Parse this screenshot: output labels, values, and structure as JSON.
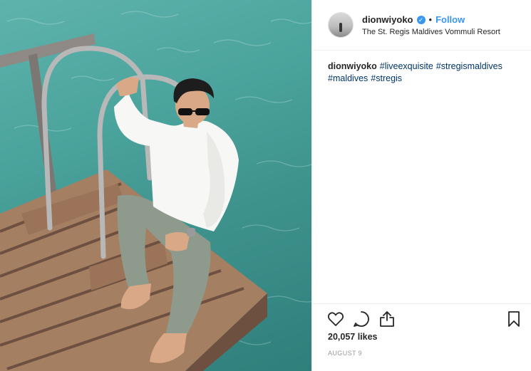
{
  "post": {
    "username": "dionwiyoko",
    "verified": true,
    "separator": "•",
    "follow_label": "Follow",
    "location": "The St. Regis Maldives Vommuli Resort",
    "caption": {
      "username": "dionwiyoko",
      "hashtags": [
        "#liveexquisite",
        "#stregismaldives",
        "#maldives",
        "#stregis"
      ]
    },
    "likes": "20,057 likes",
    "date": "AUGUST 9"
  },
  "icons": {
    "verified": "verified-badge-icon",
    "like": "heart-icon",
    "comment": "comment-icon",
    "share": "share-icon",
    "save": "bookmark-icon"
  },
  "colors": {
    "link": "#3897f0",
    "hashtag": "#003569",
    "water": "#4aa39c",
    "dock_wood": "#a57f62"
  }
}
